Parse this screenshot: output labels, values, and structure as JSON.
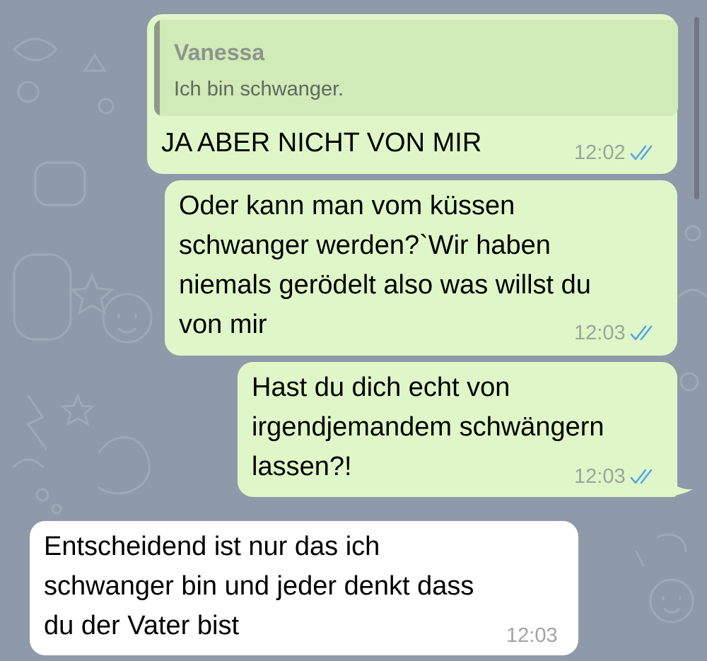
{
  "messages": [
    {
      "direction": "outgoing",
      "reply": {
        "name": "Vanessa",
        "text": "Ich bin schwanger."
      },
      "text": "JA ABER NICHT VON MIR",
      "time": "12:02",
      "status": "read"
    },
    {
      "direction": "outgoing",
      "text": "Oder kann man vom küssen\nschwanger werden?`Wir haben\nniemals gerödelt also was willst du\nvon mir",
      "time": "12:03",
      "status": "read"
    },
    {
      "direction": "outgoing",
      "text": "Hast du dich echt von\nirgendjemandem schwängern\nlassen?!",
      "time": "12:03",
      "status": "read"
    },
    {
      "direction": "incoming",
      "text": "Entscheidend ist nur das ich\nschwanger bin und jeder denkt dass\ndu der Vater bist",
      "time": "12:03"
    }
  ],
  "icons": {
    "read_receipt": "double-check-icon"
  },
  "colors": {
    "background": "#8e9aa9",
    "outgoing_bubble": "#dff7c8",
    "incoming_bubble": "#ffffff",
    "reply_background": "#d0eab8",
    "read_ticks": "#5aa4e6"
  }
}
